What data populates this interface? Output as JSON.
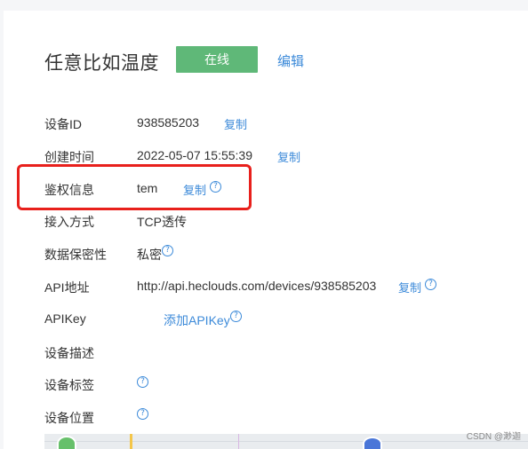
{
  "header": {
    "title": "任意比如温度",
    "status_badge": "在线",
    "edit_label": "编辑"
  },
  "details": {
    "device_id": {
      "label": "设备ID",
      "value": "938585203",
      "copy": "复制"
    },
    "created_time": {
      "label": "创建时间",
      "value": "2022-05-07 15:55:39",
      "copy": "复制"
    },
    "auth_info": {
      "label": "鉴权信息",
      "value": "tem",
      "copy": "复制",
      "help": "?"
    },
    "access_method": {
      "label": "接入方式",
      "value": "TCP透传"
    },
    "data_privacy": {
      "label": "数据保密性",
      "value": "私密",
      "help": "?"
    },
    "api_address": {
      "label": "API地址",
      "value": "http://api.heclouds.com/devices/938585203",
      "copy": "复制",
      "help": "?"
    },
    "api_key": {
      "label": "APIKey",
      "add_link": "添加APIKey",
      "help": "?"
    },
    "device_desc": {
      "label": "设备描述"
    },
    "device_tags": {
      "label": "设备标签",
      "help": "?"
    },
    "device_location": {
      "label": "设备位置",
      "help": "?"
    }
  },
  "watermark": "CSDN @渺迦",
  "colors": {
    "accent": "#3c8ad9",
    "online": "#5fb878",
    "highlight": "#e8201c"
  }
}
